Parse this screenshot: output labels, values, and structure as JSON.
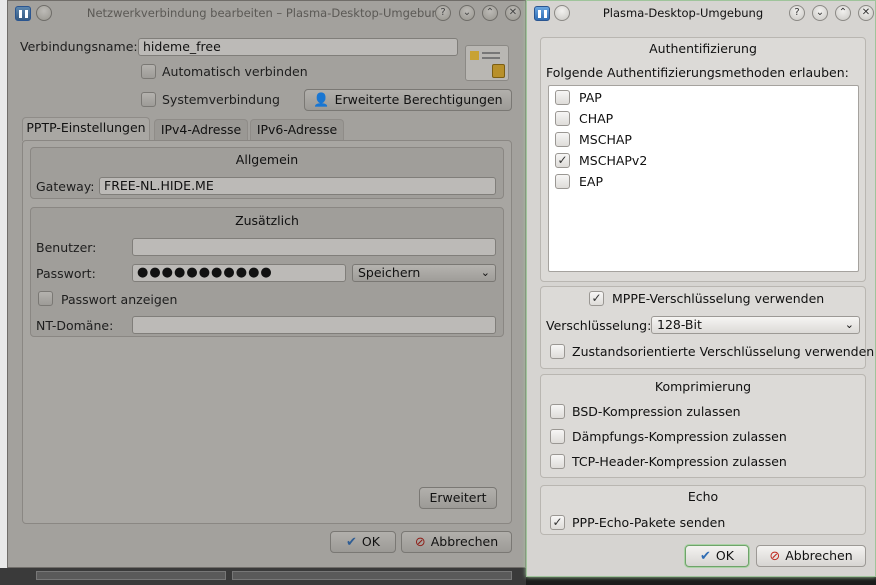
{
  "left_window": {
    "title": "Netzwerkverbindung bearbeiten – Plasma-Desktop-Umgebung",
    "connection_name_label": "Verbindungsname:",
    "connection_name_value": "hideme_free",
    "auto_connect_label": "Automatisch verbinden",
    "system_connection_label": "Systemverbindung",
    "advanced_permissions_label": "Erweiterte Berechtigungen",
    "tabs": [
      {
        "label": "PPTP-Einstellungen"
      },
      {
        "label": "IPv4-Adresse"
      },
      {
        "label": "IPv6-Adresse"
      }
    ],
    "general_group_title": "Allgemein",
    "gateway_label": "Gateway:",
    "gateway_value": "FREE-NL.HIDE.ME",
    "additional_group_title": "Zusätzlich",
    "user_label": "Benutzer:",
    "user_value": "",
    "password_label": "Passwort:",
    "password_value": "●●●●●●●●●●●",
    "password_store_option": "Speichern",
    "show_password_label": "Passwort anzeigen",
    "nt_domain_label": "NT-Domäne:",
    "nt_domain_value": "",
    "advanced_button": "Erweitert",
    "ok_button": "OK",
    "cancel_button": "Abbrechen"
  },
  "right_window": {
    "title": "Plasma-Desktop-Umgebung",
    "auth_group_title": "Authentifizierung",
    "auth_methods_label": "Folgende Authentifizierungsmethoden erlauben:",
    "auth_methods": [
      {
        "label": "PAP",
        "checked": false
      },
      {
        "label": "CHAP",
        "checked": false
      },
      {
        "label": "MSCHAP",
        "checked": false
      },
      {
        "label": "MSCHAPv2",
        "checked": true
      },
      {
        "label": "EAP",
        "checked": false
      }
    ],
    "mppe_label": "MPPE-Verschlüsselung verwenden",
    "mppe_checked": true,
    "encryption_label": "Verschlüsselung:",
    "encryption_value": "128-Bit",
    "stateful_label": "Zustandsorientierte Verschlüsselung verwenden",
    "compression_group_title": "Komprimierung",
    "bsd_label": "BSD-Kompression zulassen",
    "deflate_label": "Dämpfungs-Kompression zulassen",
    "tcp_header_label": "TCP-Header-Kompression zulassen",
    "echo_group_title": "Echo",
    "ppp_echo_label": "PPP-Echo-Pakete senden",
    "ppp_echo_checked": true,
    "ok_button": "OK",
    "cancel_button": "Abbrechen"
  },
  "icons": {
    "check": "✓",
    "help": "?",
    "minimize": "⌄",
    "maximize": "⌃",
    "close": "✕",
    "ok": "✔",
    "cancel": "⊘",
    "dropdown": "⌄"
  },
  "colors": {
    "window_bg": "#d6d4d1",
    "dimmed_window_bg": "#a3a19d",
    "focus_green": "#6fa36a",
    "cancel_red": "#c0271e",
    "ok_blue": "#2f6db4"
  }
}
